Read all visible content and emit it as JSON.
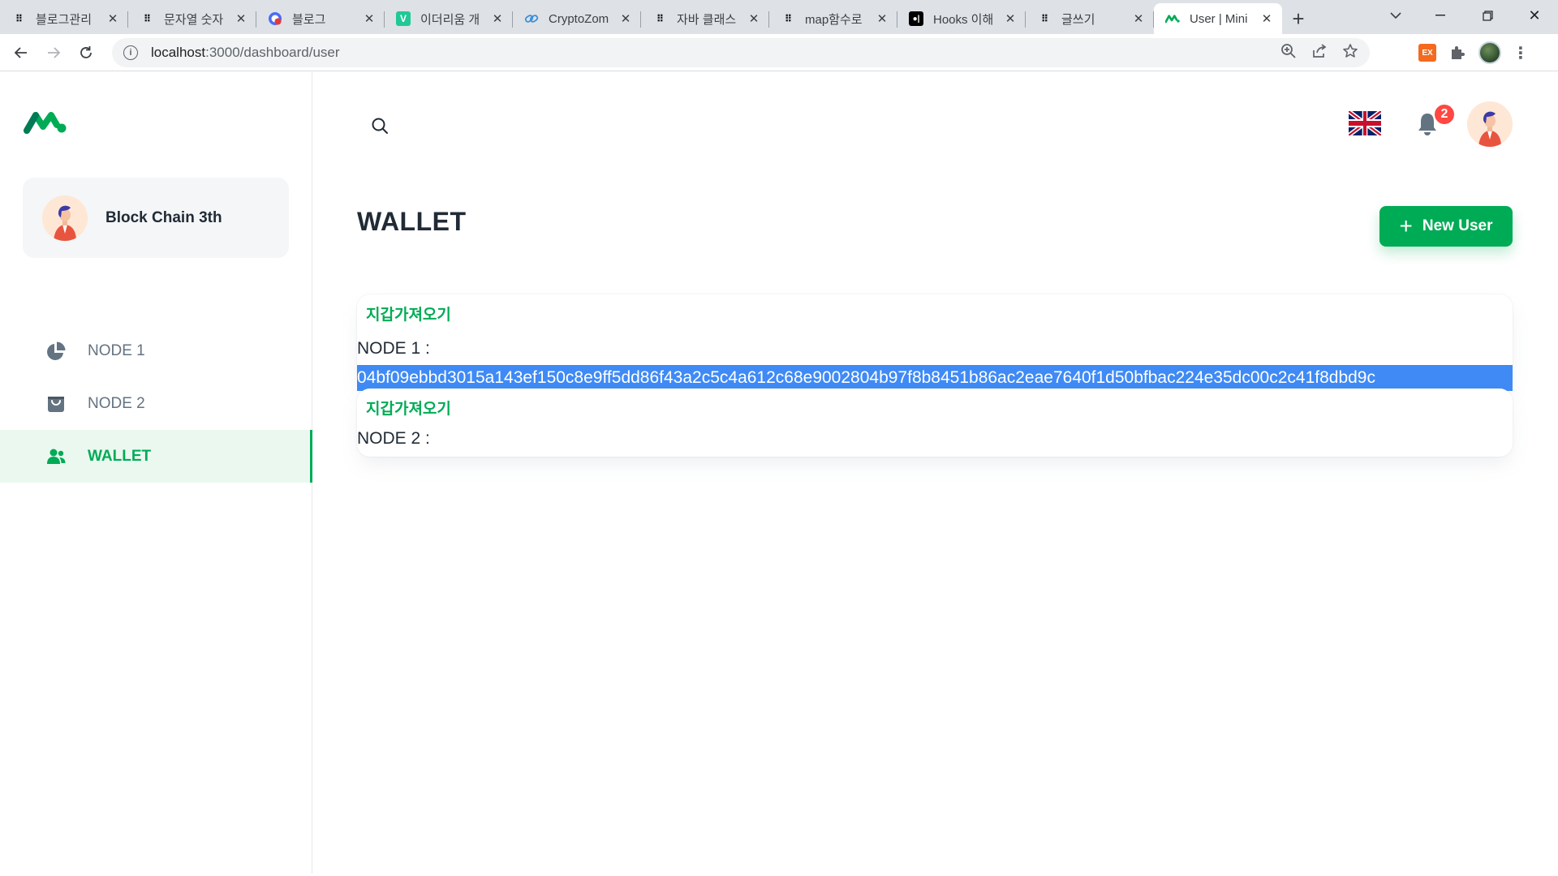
{
  "browser": {
    "tabs": [
      {
        "title": "블로그관리",
        "fav": "dots"
      },
      {
        "title": "문자열 숫자",
        "fav": "dots"
      },
      {
        "title": "블로그",
        "fav": "circle"
      },
      {
        "title": "이더리움 개",
        "fav": "v"
      },
      {
        "title": "CryptoZom",
        "fav": "chain"
      },
      {
        "title": "자바 클래스",
        "fav": "dots"
      },
      {
        "title": "map함수로",
        "fav": "dots"
      },
      {
        "title": "Hooks 이해",
        "fav": "medium"
      },
      {
        "title": "글쓰기",
        "fav": "dots"
      },
      {
        "title": "User | Mini",
        "fav": "m"
      }
    ],
    "url_host": "localhost",
    "url_path": ":3000/dashboard/user",
    "ext_label": "EX"
  },
  "sidebar": {
    "account_name": "Block Chain 3th",
    "items": [
      {
        "label": "NODE 1",
        "icon": "pie-chart-icon"
      },
      {
        "label": "NODE 2",
        "icon": "shopping-bag-icon"
      },
      {
        "label": "WALLET",
        "icon": "people-icon"
      }
    ]
  },
  "header": {
    "notification_count": "2"
  },
  "page": {
    "title": "WALLET",
    "new_user_label": "New User",
    "nodes": [
      {
        "button": "지갑가져오기",
        "label": "NODE 1 :",
        "address": "04bf09ebbd3015a143ef150c8e9ff5dd86f43a2c5c4a612c68e9002804b97f8b8451b86ac2eae7640f1d50bfbac224e35dc00c2c41f8dbd9c"
      },
      {
        "button": "지갑가져오기",
        "label": "NODE 2 :",
        "address": ""
      }
    ]
  },
  "colors": {
    "primary": "#00ab55",
    "selection": "#3f8af5",
    "badge": "#ff4842",
    "text": "#212b36",
    "muted": "#637381"
  }
}
